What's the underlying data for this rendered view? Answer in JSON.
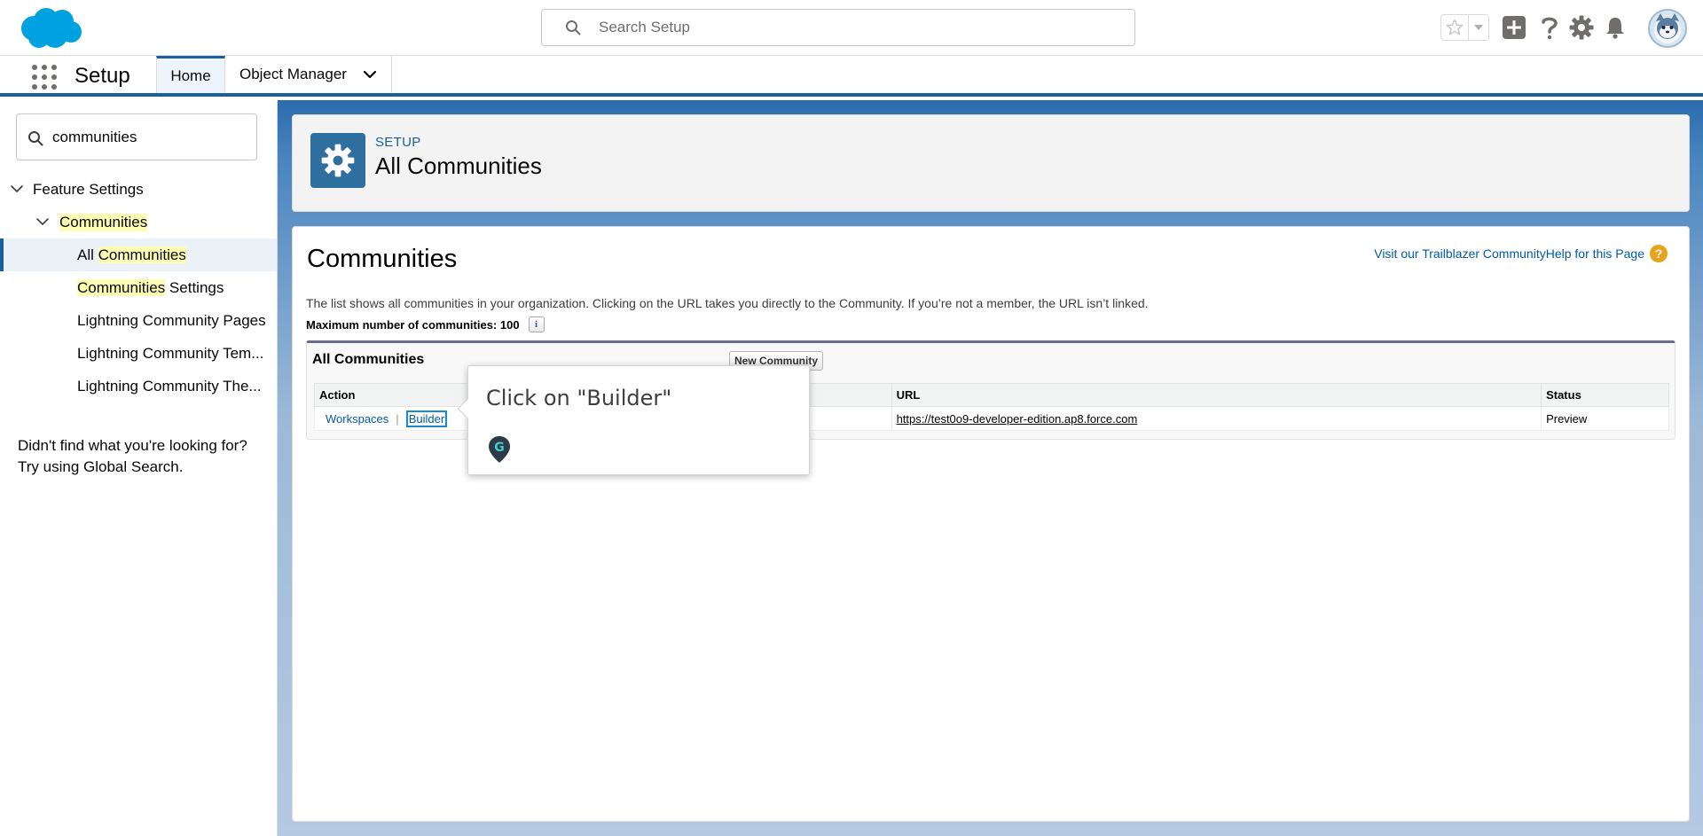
{
  "header": {
    "logo_icon": "salesforce-cloud-logo",
    "search_placeholder": "Search Setup",
    "icons": [
      "favorites-star-icon",
      "favorites-dropdown-icon",
      "global-actions-plus-icon",
      "help-question-icon",
      "setup-gear-icon",
      "notifications-bell-icon",
      "user-avatar"
    ]
  },
  "context_bar": {
    "app_name": "Setup",
    "tabs": [
      {
        "label": "Home"
      },
      {
        "label": "Object Manager"
      }
    ]
  },
  "sidebar": {
    "quickfind_value": "communities",
    "tree": {
      "feature_settings": "Feature Settings",
      "communities": "Communities",
      "items": [
        {
          "prefix": "All ",
          "match": "Communities",
          "suffix": ""
        },
        {
          "prefix": "",
          "match": "Communities",
          "suffix": " Settings"
        },
        {
          "label": "Lightning Community Pages"
        },
        {
          "label": "Lightning Community Tem..."
        },
        {
          "label": "Lightning Community The..."
        }
      ]
    },
    "no_match_line1": "Didn't find what you're looking for?",
    "no_match_line2": "Try using Global Search."
  },
  "page_header": {
    "kicker": "SETUP",
    "title": "All Communities"
  },
  "content": {
    "title": "Communities",
    "help_link": "Visit our Trailblazer CommunityHelp for this Page",
    "help_icon": "?",
    "description": "The list shows all communities in your organization. Clicking on the URL takes you directly to the Community. If you’re not a member, the URL isn’t linked.",
    "max_label": "Maximum number of communities: 100",
    "info_icon": "i",
    "list": {
      "title": "All Communities",
      "new_button": "New Community",
      "columns": {
        "action": "Action",
        "url": "URL",
        "status": "Status"
      },
      "rows": [
        {
          "workspaces": "Workspaces",
          "separator": "|",
          "builder": "Builder",
          "url": "https://test0o9-developer-edition.ap8.force.com",
          "status": "Preview"
        }
      ]
    }
  },
  "tooltip": {
    "text": "Click on \"Builder\"",
    "icon": "guide-pin-icon",
    "pin_letter": "G"
  },
  "colors": {
    "brand_blue": "#1b5f9e",
    "link_blue": "#015ba7",
    "highlight": "#fdfcb4",
    "help_orange": "#e8a21c"
  }
}
